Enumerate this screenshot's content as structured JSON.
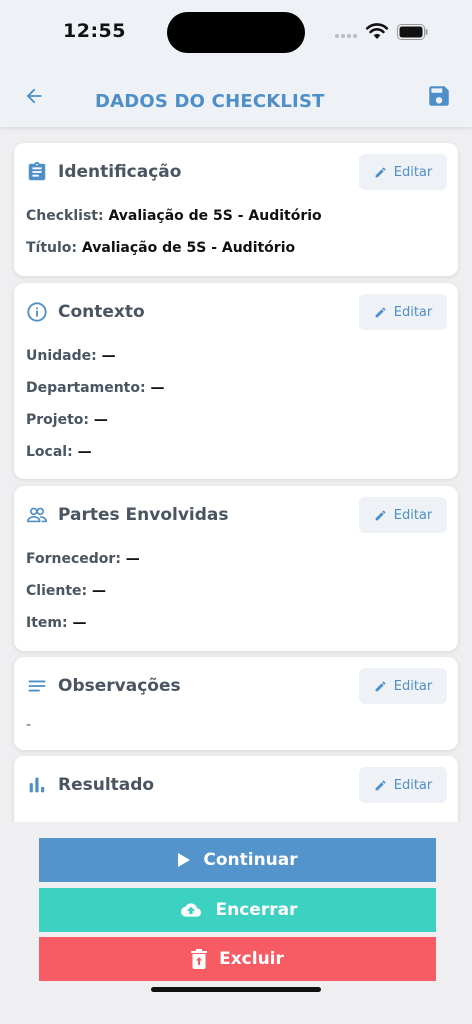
{
  "status_bar": {
    "time": "12:55"
  },
  "header": {
    "title": "DADOS DO CHECKLIST"
  },
  "edit_label": "Editar",
  "sections": {
    "identificacao": {
      "title": "Identificação",
      "checklist_label": "Checklist:",
      "checklist_value": "Avaliação de 5S - Auditório",
      "titulo_label": "Título:",
      "titulo_value": "Avaliação de 5S - Auditório"
    },
    "contexto": {
      "title": "Contexto",
      "unidade_label": "Unidade:",
      "unidade_value": "—",
      "departamento_label": "Departamento:",
      "departamento_value": "—",
      "projeto_label": "Projeto:",
      "projeto_value": "—",
      "local_label": "Local:",
      "local_value": "—"
    },
    "partes": {
      "title": "Partes Envolvidas",
      "fornecedor_label": "Fornecedor:",
      "fornecedor_value": "—",
      "cliente_label": "Cliente:",
      "cliente_value": "—",
      "item_label": "Item:",
      "item_value": "—"
    },
    "observacoes": {
      "title": "Observações",
      "text": "-"
    },
    "resultado": {
      "title": "Resultado"
    }
  },
  "actions": {
    "continue_label": "Continuar",
    "close_label": "Encerrar",
    "delete_label": "Excluir"
  },
  "colors": {
    "accent": "#4e8fc7",
    "continue": "#5294cb",
    "close": "#3dd1c2",
    "delete": "#f75c64"
  }
}
